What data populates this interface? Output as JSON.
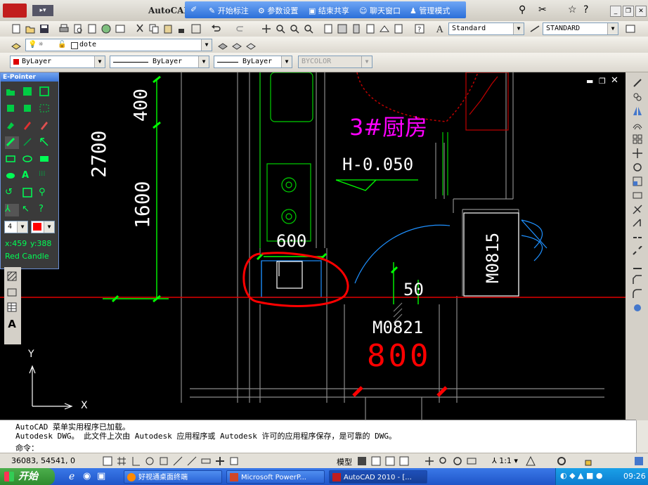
{
  "window": {
    "title": "AutoCAD"
  },
  "share_bar": {
    "items": [
      "开始标注",
      "参数设置",
      "结束共享",
      "聊天窗口",
      "管理模式"
    ]
  },
  "toolbar": {
    "text_style": "Standard",
    "dim_style": "STANDARD",
    "layer": "dote",
    "color": "ByLayer",
    "linetype": "ByLayer",
    "lineweight": "ByLayer",
    "plotstyle": "BYCOLOR"
  },
  "epointer": {
    "title": "E-Pointer",
    "size": "4",
    "coord_x": "x:459",
    "coord_y": "y:388",
    "color_name": "Red Candle",
    "pen_color": "#ff0000"
  },
  "drawing": {
    "dim_2700": "2700",
    "dim_400": "400",
    "dim_1600": "1600",
    "room_label": "3#厨房",
    "elevation": "H-0.050",
    "dim_600": "600",
    "door_m0815": "M0815",
    "dim_50": "50",
    "door_m0821": "M0821",
    "dim_800": "800",
    "axis_x": "X",
    "axis_y": "Y",
    "colors": {
      "green": "#00ff00",
      "magenta": "#ff00ff",
      "red": "#ff0000",
      "white": "#ffffff",
      "cyan": "#00bfff"
    }
  },
  "command": {
    "line1": "AutoCAD 菜单实用程序已加载。",
    "line2": "Autodesk DWG。  此文件上次由 Autodesk 应用程序或 Autodesk 许可的应用程序保存，是可靠的 DWG。",
    "prompt": "命令："
  },
  "status": {
    "coords": "36083, 54541, 0",
    "model": "模型",
    "scale": "1:1"
  },
  "taskbar": {
    "start": "开始",
    "tasks": [
      "好视通桌面终端",
      "Microsoft PowerP...",
      "AutoCAD 2010 - [..."
    ],
    "clock": "09:26"
  }
}
